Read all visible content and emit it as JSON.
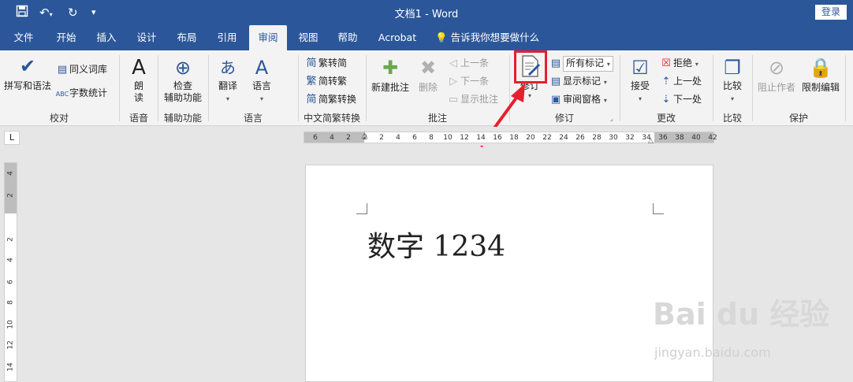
{
  "titlebar": {
    "title": "文档1  -  Word",
    "login": "登录"
  },
  "tabs": [
    {
      "label": "文件"
    },
    {
      "label": "开始"
    },
    {
      "label": "插入"
    },
    {
      "label": "设计"
    },
    {
      "label": "布局"
    },
    {
      "label": "引用"
    },
    {
      "label": "审阅"
    },
    {
      "label": "视图"
    },
    {
      "label": "帮助"
    },
    {
      "label": "Acrobat"
    }
  ],
  "tellme": "告诉我你想要做什么",
  "ribbon": {
    "proofing": {
      "spelling": "拼写和语法",
      "thesaurus": "同义词库",
      "wordcount": "字数统计",
      "group": "校对"
    },
    "speech": {
      "read": "朗读",
      "group": "语音"
    },
    "accessibility": {
      "check_line1": "检查",
      "check_line2": "辅助功能",
      "group": "辅助功能"
    },
    "language": {
      "translate": "翻译",
      "language": "语言",
      "group": "语言"
    },
    "chinese": {
      "to_trad": "繁转简",
      "to_simp": "简转繁",
      "convert": "简繁转换",
      "group": "中文简繁转换"
    },
    "comments": {
      "new": "新建批注",
      "delete": "删除",
      "prev": "上一条",
      "next": "下一条",
      "show": "显示批注",
      "group": "批注"
    },
    "tracking": {
      "track": "修订",
      "all_markup": "所有标记",
      "show_markup": "显示标记",
      "review_pane": "审阅窗格",
      "group": "修订"
    },
    "changes": {
      "accept": "接受",
      "reject": "拒绝",
      "prev": "上一处",
      "next": "下一处",
      "group": "更改"
    },
    "compare": {
      "compare": "比较",
      "group": "比较"
    },
    "protect": {
      "block": "阻止作者",
      "restrict": "限制编辑",
      "group": "保护"
    }
  },
  "ruler": {
    "h_left": [
      "6",
      "4",
      "2",
      "2"
    ],
    "h_right": [
      "2",
      "4",
      "6",
      "8",
      "10",
      "12",
      "14",
      "16",
      "18",
      "20",
      "22",
      "24",
      "26",
      "28",
      "30",
      "32",
      "34",
      "36",
      "38",
      "40",
      "42"
    ],
    "v": [
      "4",
      "2",
      "2",
      "4",
      "6",
      "8",
      "10",
      "12",
      "14"
    ]
  },
  "document": {
    "text": "数字 1234"
  },
  "watermark": {
    "brand": "Bai du 经验",
    "url": "jingyan.baidu.com"
  },
  "colors": {
    "accent": "#2b579a",
    "highlight": "#e5202e"
  }
}
